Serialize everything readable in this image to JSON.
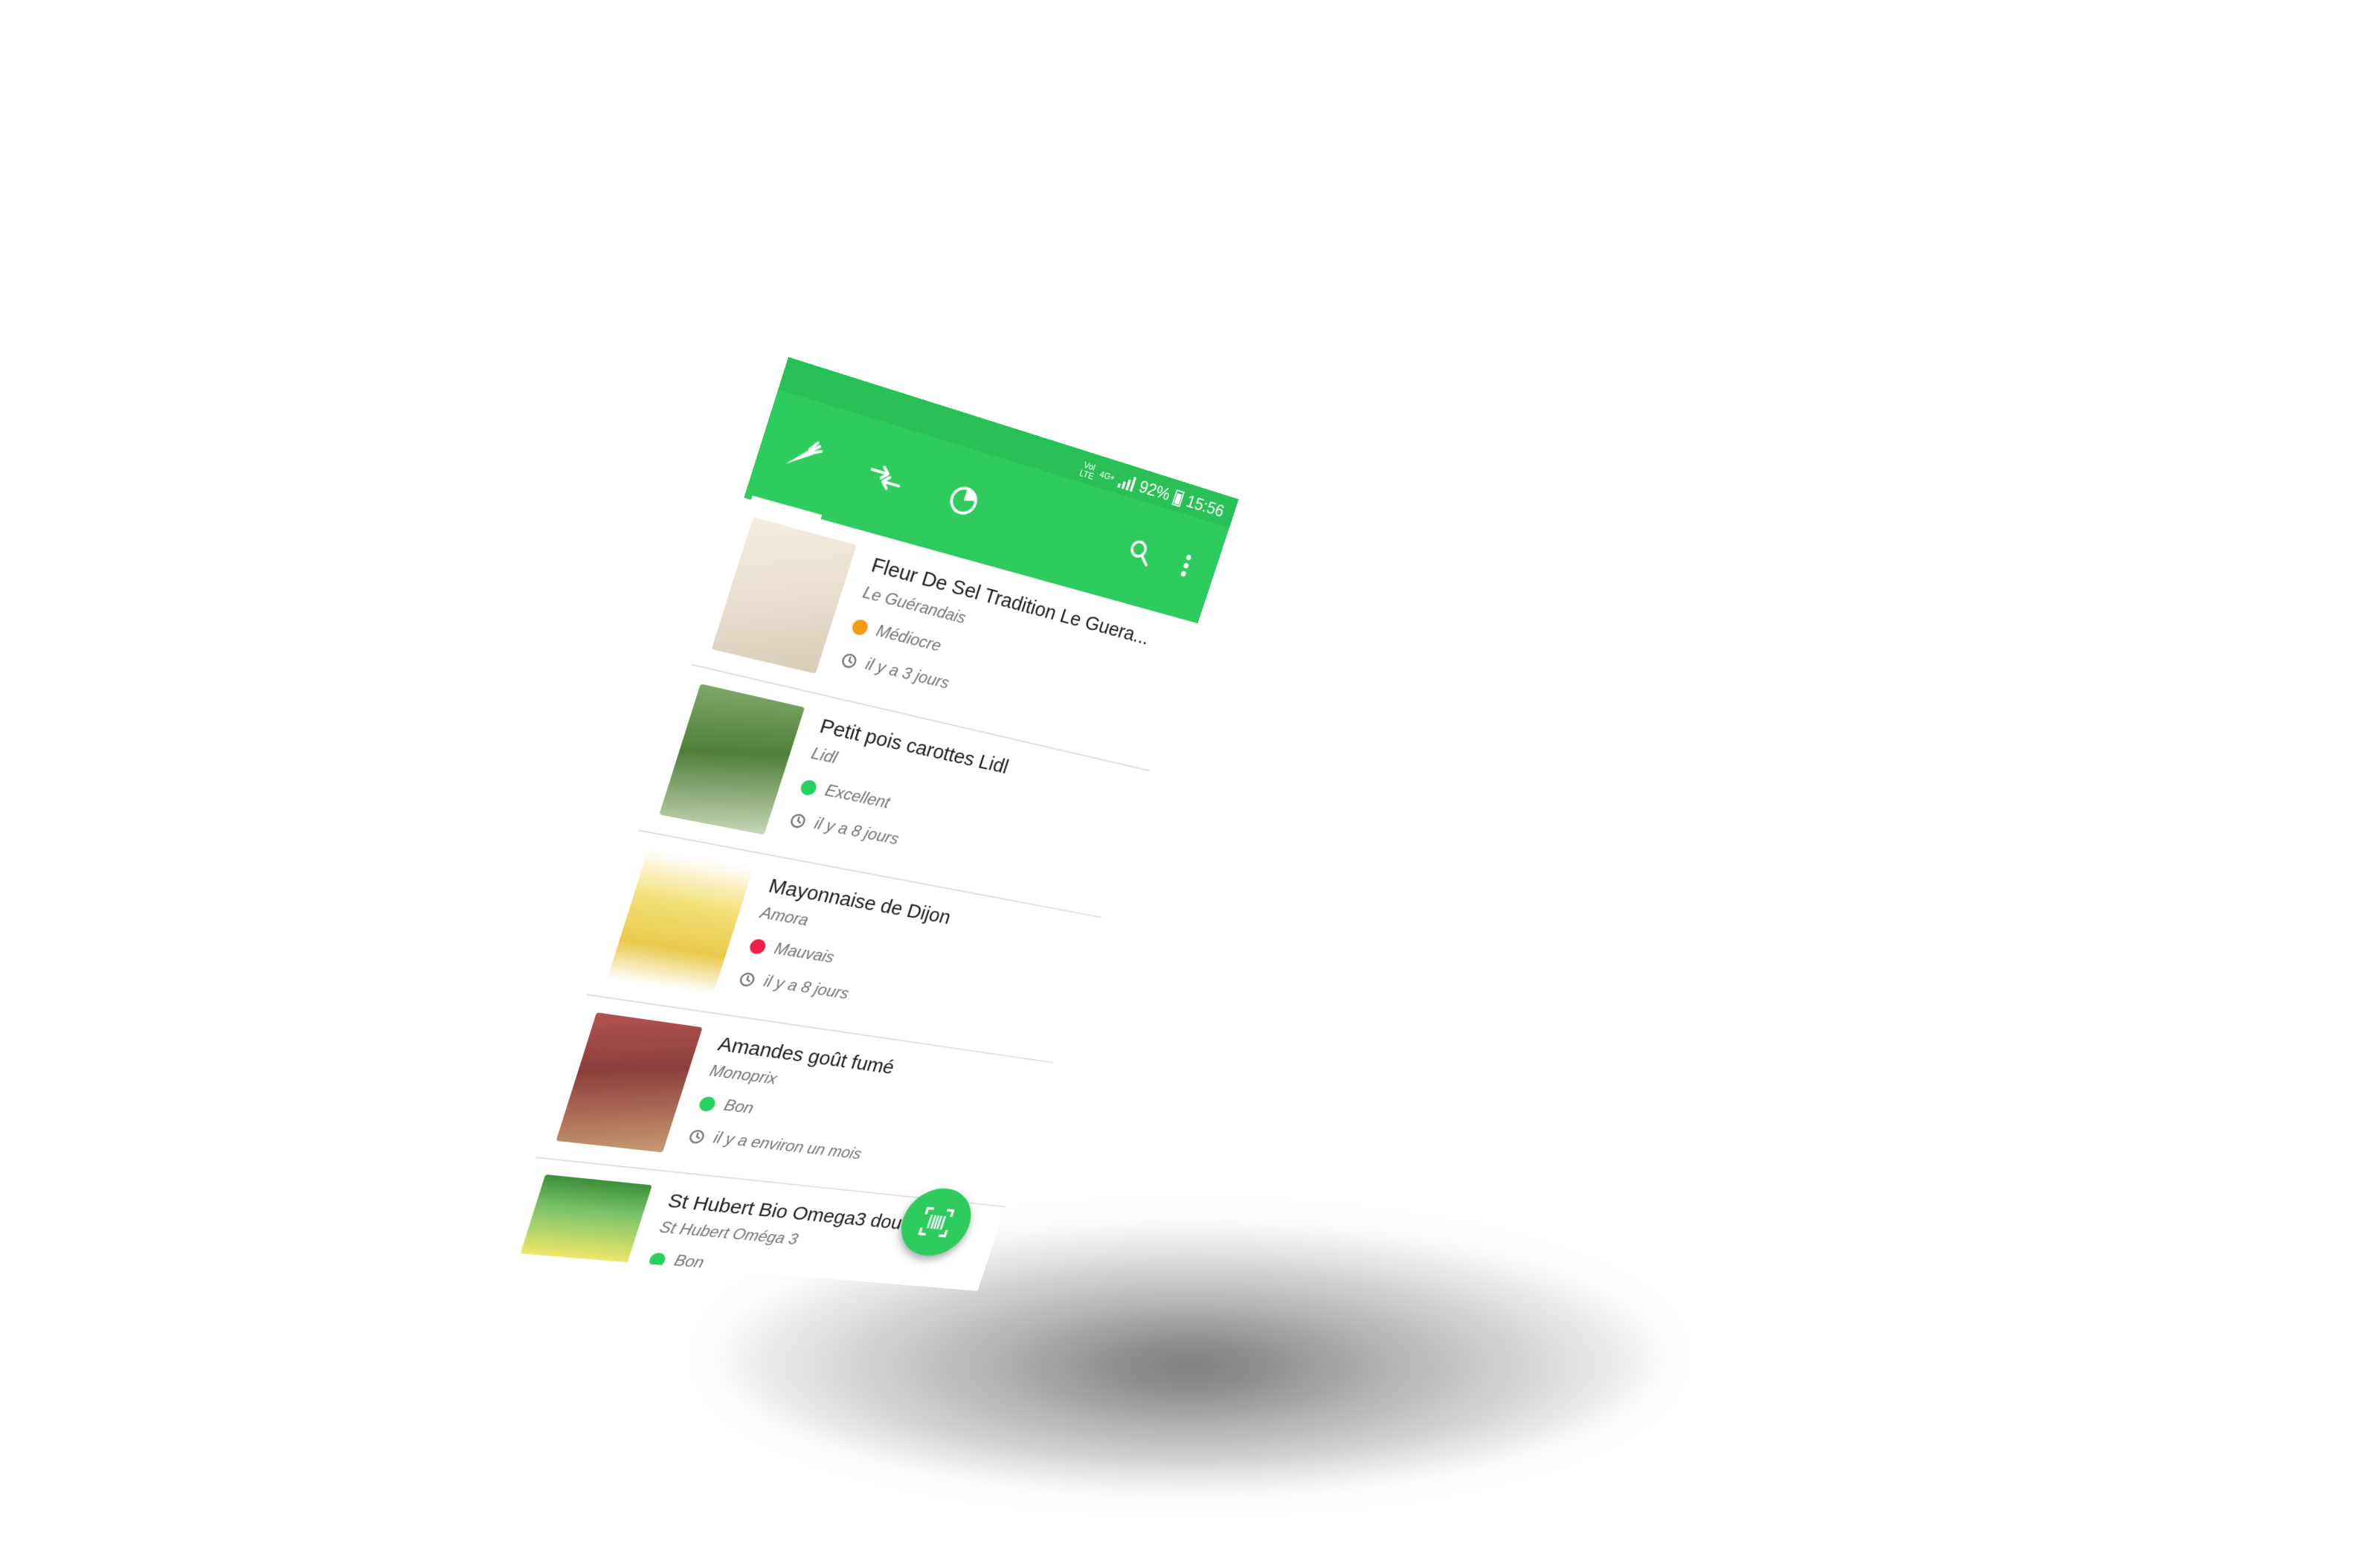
{
  "status_bar": {
    "carrier_top": "Vol",
    "carrier_bottom": "LTE",
    "network": "4G+",
    "battery": "92%",
    "time": "15:56"
  },
  "tabs": [
    {
      "icon": "carrot-icon",
      "selected": true
    },
    {
      "icon": "compare-arrows-icon",
      "selected": false
    },
    {
      "icon": "pie-chart-icon",
      "selected": false
    }
  ],
  "actions": {
    "search_icon": "search-icon",
    "menu_icon": "more-vert-icon"
  },
  "colors": {
    "primary": "#2ecc5f",
    "status_bar": "#29c057",
    "grade_mediocre": "#f39c12",
    "grade_excellent": "#27d15f",
    "grade_mauvais": "#ee1f4a",
    "grade_bon": "#27d15f"
  },
  "products": [
    {
      "name": "Fleur De Sel Tradition Le Guera...",
      "brand": "Le Guérandais",
      "grade": "Médiocre",
      "grade_color": "#f39c12",
      "time": "il y a 3 jours"
    },
    {
      "name": "Petit pois carottes Lidl",
      "brand": "Lidl",
      "grade": "Excellent",
      "grade_color": "#27d15f",
      "time": "il y a 8 jours"
    },
    {
      "name": "Mayonnaise de Dijon",
      "brand": "Amora",
      "grade": "Mauvais",
      "grade_color": "#ee1f4a",
      "time": "il y a 8 jours"
    },
    {
      "name": "Amandes goût fumé",
      "brand": "Monoprix",
      "grade": "Bon",
      "grade_color": "#27d15f",
      "time": "il y a environ un mois"
    },
    {
      "name": "St Hubert Bio Omega3 dou",
      "brand": "St Hubert Oméga 3",
      "grade": "Bon",
      "grade_color": "#27d15f",
      "time": ""
    }
  ],
  "fab": {
    "icon": "barcode-scan-icon"
  }
}
